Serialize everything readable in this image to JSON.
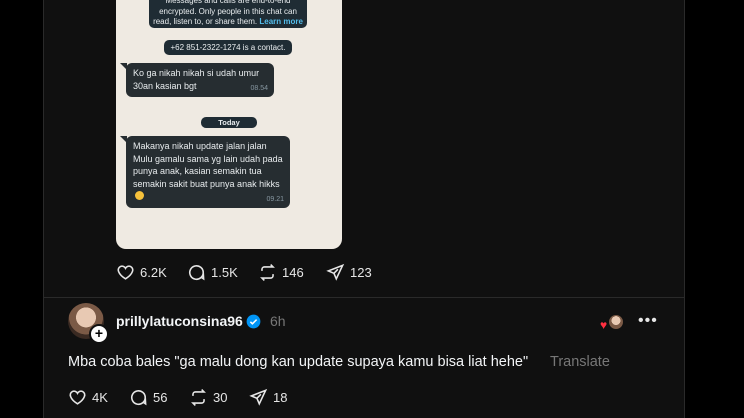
{
  "screenshot": {
    "encryption_notice": "Messages and calls are end-to-end encrypted. Only people in this chat can read, listen to, or share them.",
    "encryption_more": "Learn more",
    "contact_notice": "+62 851-2322-1274 is a contact.",
    "message1": {
      "text": "Ko ga nikah nikah si udah umur 30an kasian bgt",
      "time": "08.54"
    },
    "date_divider": "Today",
    "message2": {
      "text": "Makanya nikah update jalan jalan Mulu gamalu sama yg lain udah pada punya anak, kasian semakin tua semakin sakit buat punya anak hikks",
      "time": "09.21"
    }
  },
  "post_actions": {
    "likes": "6.2K",
    "replies": "1.5K",
    "reposts": "146",
    "shares": "123"
  },
  "reply": {
    "username": "prillylatuconsina96",
    "time_ago": "6h",
    "text": "Mba coba bales \"ga malu dong kan update supaya kamu bisa liat hehe\"",
    "translate_label": "Translate",
    "actions": {
      "likes": "4K",
      "replies": "56",
      "reposts": "30",
      "shares": "18"
    }
  },
  "colors": {
    "background": "#101010",
    "verified": "#0095f6",
    "like_red": "#ff3040"
  },
  "icons": [
    "heart-icon",
    "comment-icon",
    "repost-icon",
    "share-icon",
    "verified-badge-icon",
    "more-icon",
    "plus-icon"
  ]
}
